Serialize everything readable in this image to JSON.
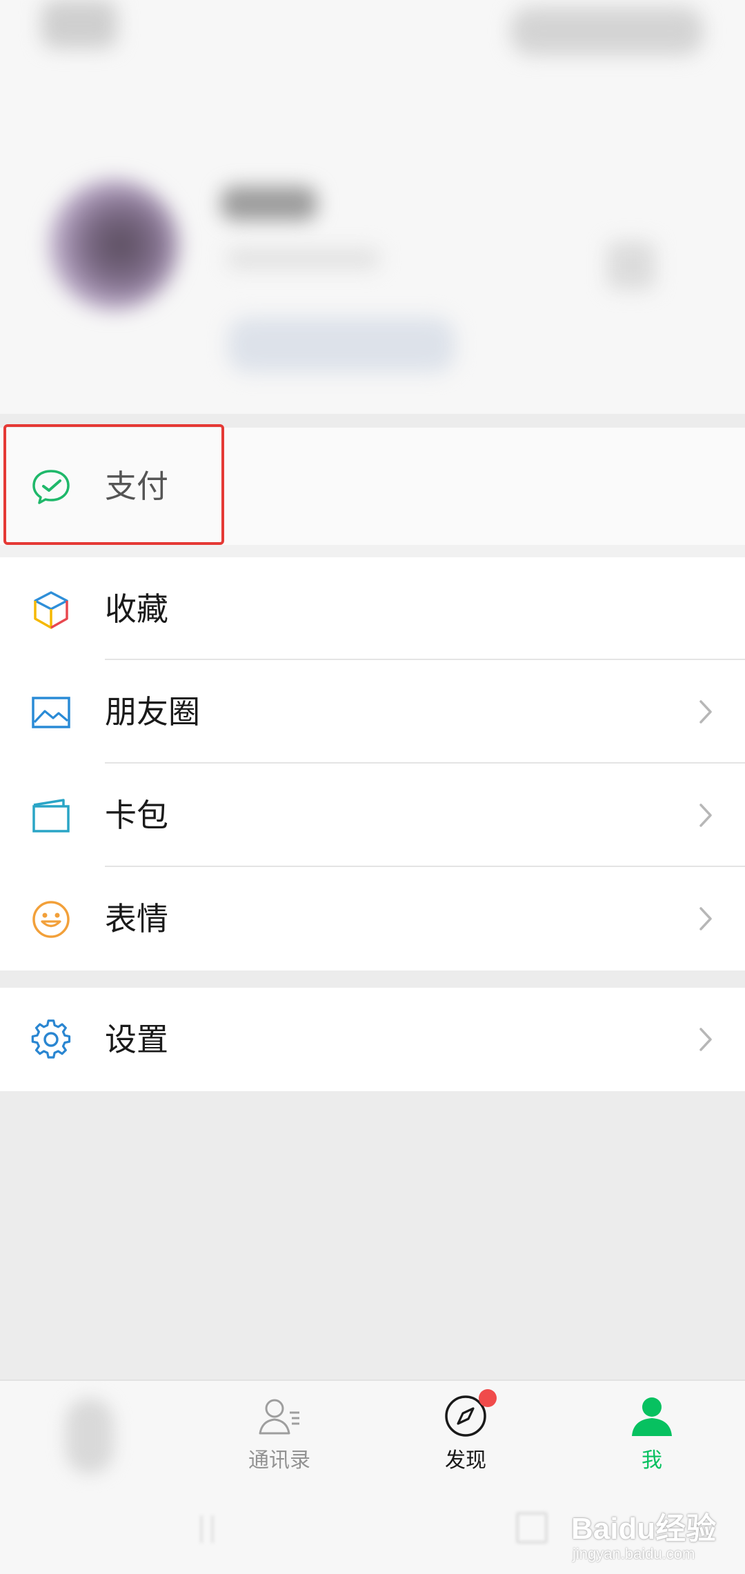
{
  "menu": {
    "pay": {
      "label": "支付",
      "icon": "wechat-pay-icon"
    },
    "items": [
      {
        "label": "收藏",
        "icon": "favorites-cube-icon"
      },
      {
        "label": "朋友圈",
        "icon": "moments-picture-icon"
      },
      {
        "label": "卡包",
        "icon": "card-wallet-icon"
      },
      {
        "label": "表情",
        "icon": "smiley-face-icon"
      }
    ],
    "settings": {
      "label": "设置",
      "icon": "gear-icon"
    }
  },
  "tabbar": {
    "tabs": [
      {
        "label": "",
        "icon": "chats-icon"
      },
      {
        "label": "通讯录",
        "icon": "contacts-icon"
      },
      {
        "label": "发现",
        "icon": "compass-icon",
        "badge": "red-dot"
      },
      {
        "label": "我",
        "icon": "me-person-icon",
        "active": true
      }
    ]
  },
  "watermark": {
    "text": "Baidu经验",
    "sub": "jingyan.baidu.com"
  },
  "colors": {
    "accent": "#07c160",
    "highlight": "#e53935",
    "badge": "#f04b4b"
  }
}
